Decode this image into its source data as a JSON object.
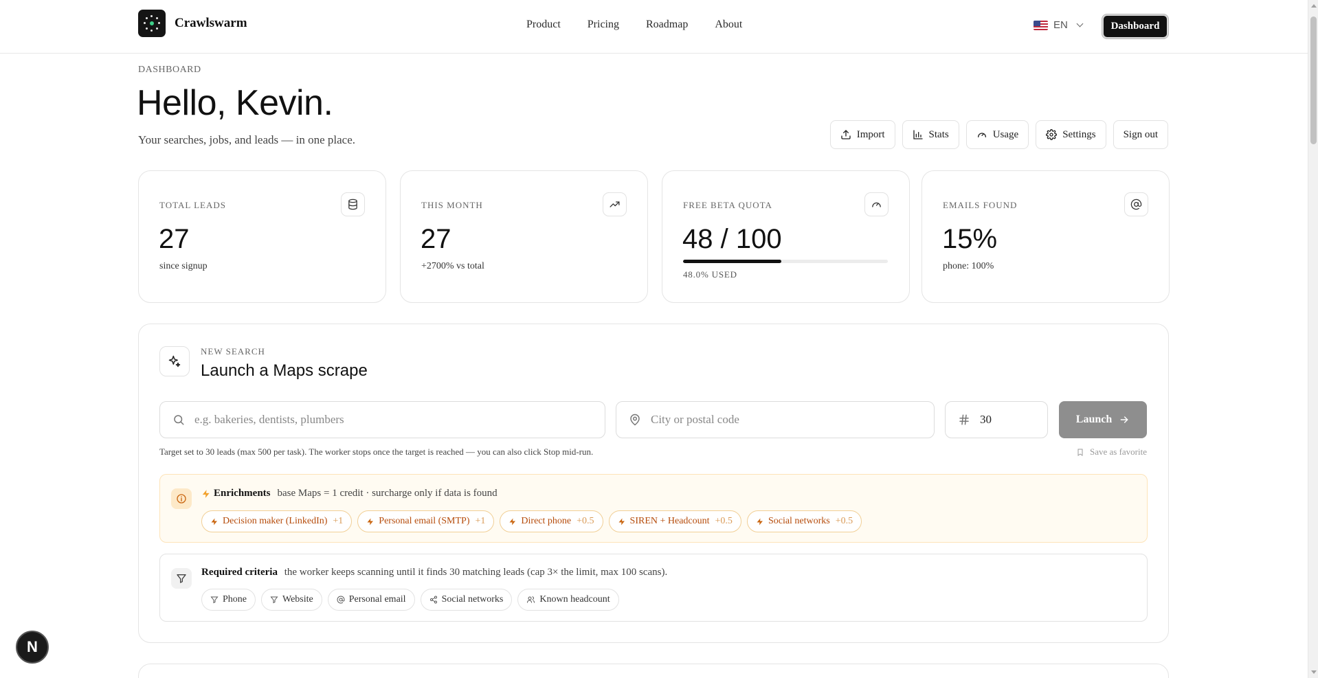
{
  "header": {
    "brand": "Crawlswarm",
    "nav": [
      "Product",
      "Pricing",
      "Roadmap",
      "About"
    ],
    "language": "EN",
    "dashboard_button": "Dashboard"
  },
  "intro": {
    "eyebrow": "DASHBOARD",
    "greeting": "Hello, Kevin.",
    "subtitle": "Your searches, jobs, and leads — in one place."
  },
  "actions": [
    "Import",
    "Stats",
    "Usage",
    "Settings",
    "Sign out"
  ],
  "stats": {
    "total_leads": {
      "label": "TOTAL LEADS",
      "value": "27",
      "sub": "since signup",
      "icon": "database-icon"
    },
    "this_month": {
      "label": "THIS MONTH",
      "value": "27",
      "sub": "+2700% vs total",
      "icon": "trending-up-icon"
    },
    "quota": {
      "label": "FREE BETA QUOTA",
      "value": "48 / 100",
      "progress": 0.48,
      "used": "48.0% USED",
      "icon": "gauge-icon"
    },
    "emails": {
      "label": "EMAILS FOUND",
      "value": "15%",
      "sub": "phone: 100%",
      "icon": "at-icon"
    }
  },
  "search": {
    "eyebrow": "NEW SEARCH",
    "title": "Launch a Maps scrape",
    "query_placeholder": "e.g. bakeries, dentists, plumbers",
    "location_placeholder": "City or postal code",
    "count_value": "30",
    "launch_label": "Launch",
    "hint": "Target set to 30 leads (max 500 per task). The worker stops once the target is reached — you can also click Stop mid-run.",
    "favorite_label": "Save as favorite"
  },
  "enrichments": {
    "title": "Enrichments",
    "description": "base Maps = 1 credit · surcharge only if data is found",
    "chips": [
      {
        "label": "Decision maker (LinkedIn)",
        "cost": "+1"
      },
      {
        "label": "Personal email (SMTP)",
        "cost": "+1"
      },
      {
        "label": "Direct phone",
        "cost": "+0.5"
      },
      {
        "label": "SIREN + Headcount",
        "cost": "+0.5"
      },
      {
        "label": "Social networks",
        "cost": "+0.5"
      }
    ]
  },
  "criteria": {
    "title": "Required criteria",
    "description": "the worker keeps scanning until it finds 30 matching leads (cap 3× the limit, max 100 scans).",
    "chips": [
      "Phone",
      "Website",
      "Personal email",
      "Social networks",
      "Known headcount"
    ]
  },
  "badge": "N",
  "colors": {
    "accent": "#111111",
    "enrich_text": "#b54b0a",
    "enrich_bg": "#fffbf2"
  }
}
